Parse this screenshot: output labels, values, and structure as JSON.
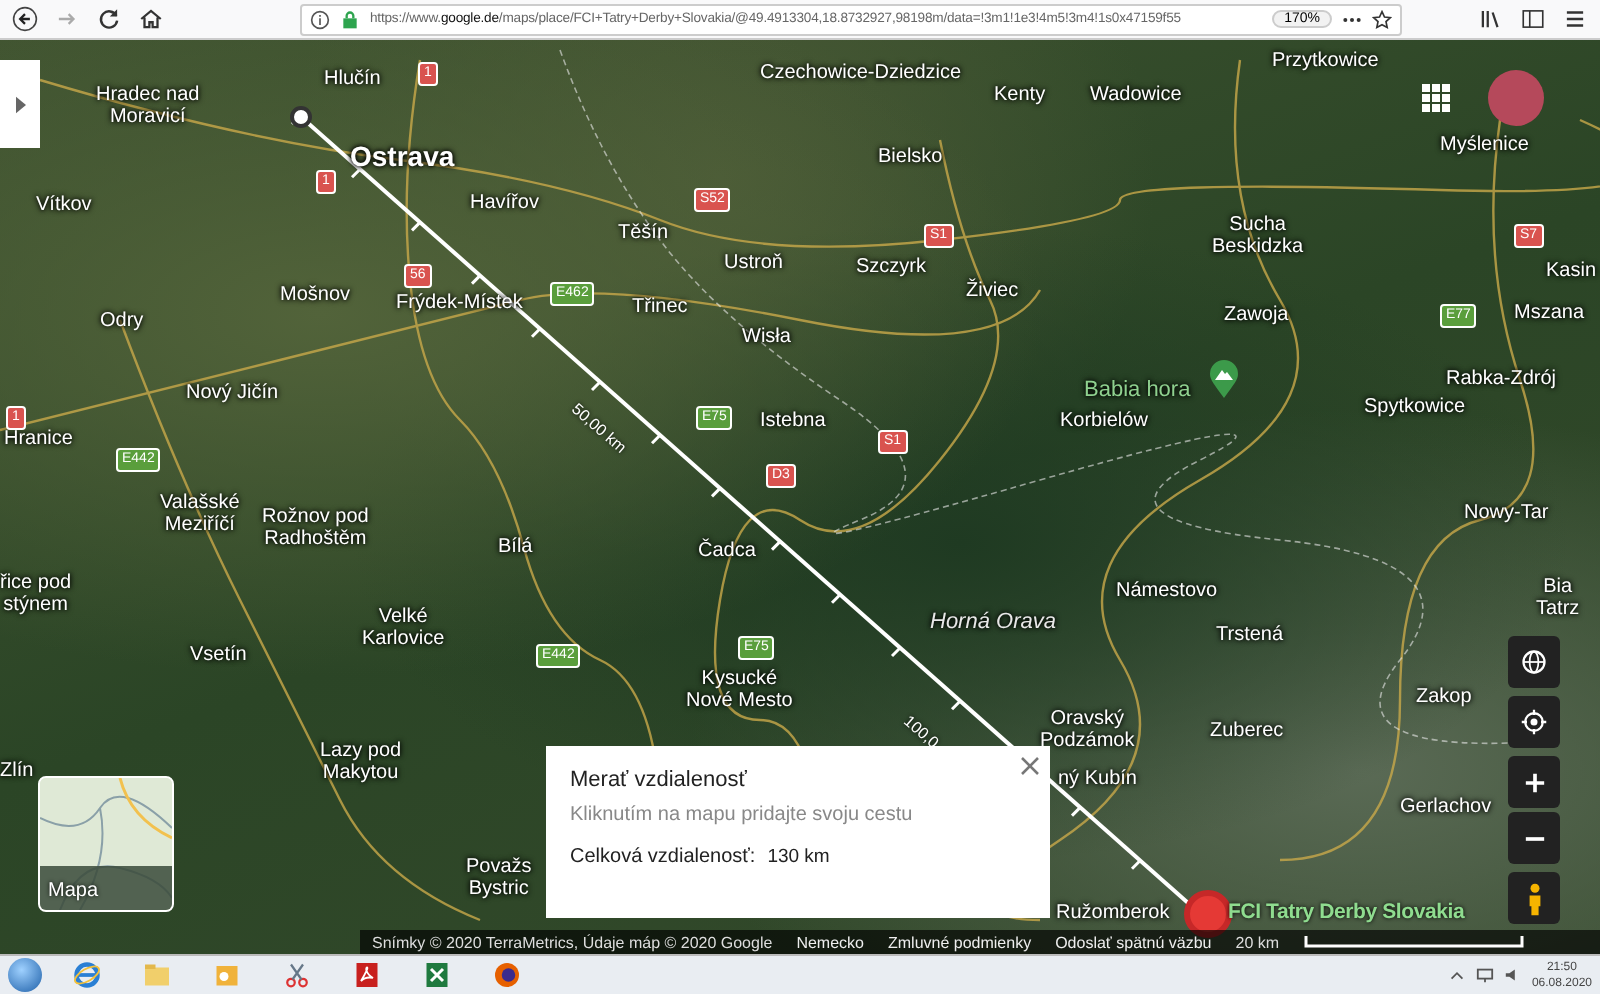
{
  "browser": {
    "url": "https://www.**google.de**/maps/place/FCI+Tatry+Derby+Slovakia/@49.4913304,18.8732927,98198m/data=!3m1!1e3!4m5!3m4!1s0x47159f55",
    "zoom": "170%"
  },
  "map": {
    "labels": [
      {
        "text": "Hradec nad\nMoravicí",
        "kind": "place"
      },
      {
        "text": "Hlučín",
        "kind": "place"
      },
      {
        "text": "Czechowice-Dziedzice",
        "kind": "place"
      },
      {
        "text": "Kenty",
        "kind": "place"
      },
      {
        "text": "Wadowice",
        "kind": "place"
      },
      {
        "text": "Przytkowice",
        "kind": "place"
      },
      {
        "text": "Ostrava",
        "kind": "city"
      },
      {
        "text": "Bielsko",
        "kind": "place"
      },
      {
        "text": "Myślenice",
        "kind": "place"
      },
      {
        "text": "Vítkov",
        "kind": "place"
      },
      {
        "text": "Havířov",
        "kind": "place"
      },
      {
        "text": "Těšín",
        "kind": "place"
      },
      {
        "text": "Ustroň",
        "kind": "place"
      },
      {
        "text": "Szczyrk",
        "kind": "place"
      },
      {
        "text": "Sucha\nBeskidzka",
        "kind": "place"
      },
      {
        "text": "Kasin",
        "kind": "place"
      },
      {
        "text": "Odry",
        "kind": "place"
      },
      {
        "text": "Mošnov",
        "kind": "place"
      },
      {
        "text": "Frýdek-Místek",
        "kind": "place"
      },
      {
        "text": "Třinec",
        "kind": "place"
      },
      {
        "text": "Wisła",
        "kind": "place"
      },
      {
        "text": "Živiec",
        "kind": "place"
      },
      {
        "text": "Zawoja",
        "kind": "place"
      },
      {
        "text": "Mszana",
        "kind": "place"
      },
      {
        "text": "Hranice",
        "kind": "place"
      },
      {
        "text": "Nový Jičín",
        "kind": "place"
      },
      {
        "text": "Istebna",
        "kind": "place"
      },
      {
        "text": "Babia hora",
        "kind": "peak"
      },
      {
        "text": "Korbielów",
        "kind": "place"
      },
      {
        "text": "Spytkowice",
        "kind": "place"
      },
      {
        "text": "Rabka-Zdrój",
        "kind": "place"
      },
      {
        "text": "Valašské\nMeziříčí",
        "kind": "place"
      },
      {
        "text": "Rožnov pod\nRadhoštěm",
        "kind": "place"
      },
      {
        "text": "Bílá",
        "kind": "place"
      },
      {
        "text": "Čadca",
        "kind": "place"
      },
      {
        "text": "Nowy-Tar",
        "kind": "place"
      },
      {
        "text": "řice pod\nstýnem",
        "kind": "place"
      },
      {
        "text": "Velké\nKarlovice",
        "kind": "place"
      },
      {
        "text": "Horná Orava",
        "kind": "region"
      },
      {
        "text": "Námestovo",
        "kind": "place"
      },
      {
        "text": "Trstená",
        "kind": "place"
      },
      {
        "text": "Bia\nTatrz",
        "kind": "place"
      },
      {
        "text": "Vsetín",
        "kind": "place"
      },
      {
        "text": "Kysucké\nNové Mesto",
        "kind": "place"
      },
      {
        "text": "Oravský\nPodzámok",
        "kind": "place"
      },
      {
        "text": "Zuberec",
        "kind": "place"
      },
      {
        "text": "Zakop",
        "kind": "place"
      },
      {
        "text": "Zlín",
        "kind": "place"
      },
      {
        "text": "Lazy pod\nMakytou",
        "kind": "place"
      },
      {
        "text": "ný Kubín",
        "kind": "place"
      },
      {
        "text": "Gerlachov",
        "kind": "place"
      },
      {
        "text": "Považs\nBystric",
        "kind": "place"
      },
      {
        "text": "Ružomberok",
        "kind": "place"
      }
    ],
    "shields": [
      {
        "text": "1",
        "color": "#d9534f"
      },
      {
        "text": "1",
        "color": "#d9534f"
      },
      {
        "text": "S52",
        "color": "#d9534f"
      },
      {
        "text": "S1",
        "color": "#d9534f"
      },
      {
        "text": "S7",
        "color": "#d9534f"
      },
      {
        "text": "56",
        "color": "#d9534f"
      },
      {
        "text": "E462",
        "color": "#5a9e3c"
      },
      {
        "text": "E77",
        "color": "#5a9e3c"
      },
      {
        "text": "1",
        "color": "#d9534f"
      },
      {
        "text": "E75",
        "color": "#5a9e3c"
      },
      {
        "text": "E442",
        "color": "#5a9e3c"
      },
      {
        "text": "S1",
        "color": "#d9534f"
      },
      {
        "text": "D3",
        "color": "#d9534f"
      },
      {
        "text": "E442",
        "color": "#5a9e3c"
      },
      {
        "text": "E75",
        "color": "#5a9e3c"
      }
    ],
    "measure_labels": [
      "50,00 km",
      "100,0"
    ],
    "pin_label": "FCI Tatry Derby Slovakia",
    "layer_label": "Mapa"
  },
  "measure_card": {
    "title": "Merať vzdialenosť",
    "hint": "Kliknutím na mapu pridajte svoju cestu",
    "total_label": "Celková vzdialenosť:",
    "total_value": "130 km"
  },
  "attribution": {
    "items": [
      "Snímky © 2020 TerraMetrics, Údaje máp © 2020 Google",
      "Nemecko",
      "Zmluvné podmienky",
      "Odoslať spätnú väzbu"
    ],
    "scale": "20 km"
  },
  "taskbar": {
    "time": "21:50",
    "date": "06.08.2020"
  }
}
